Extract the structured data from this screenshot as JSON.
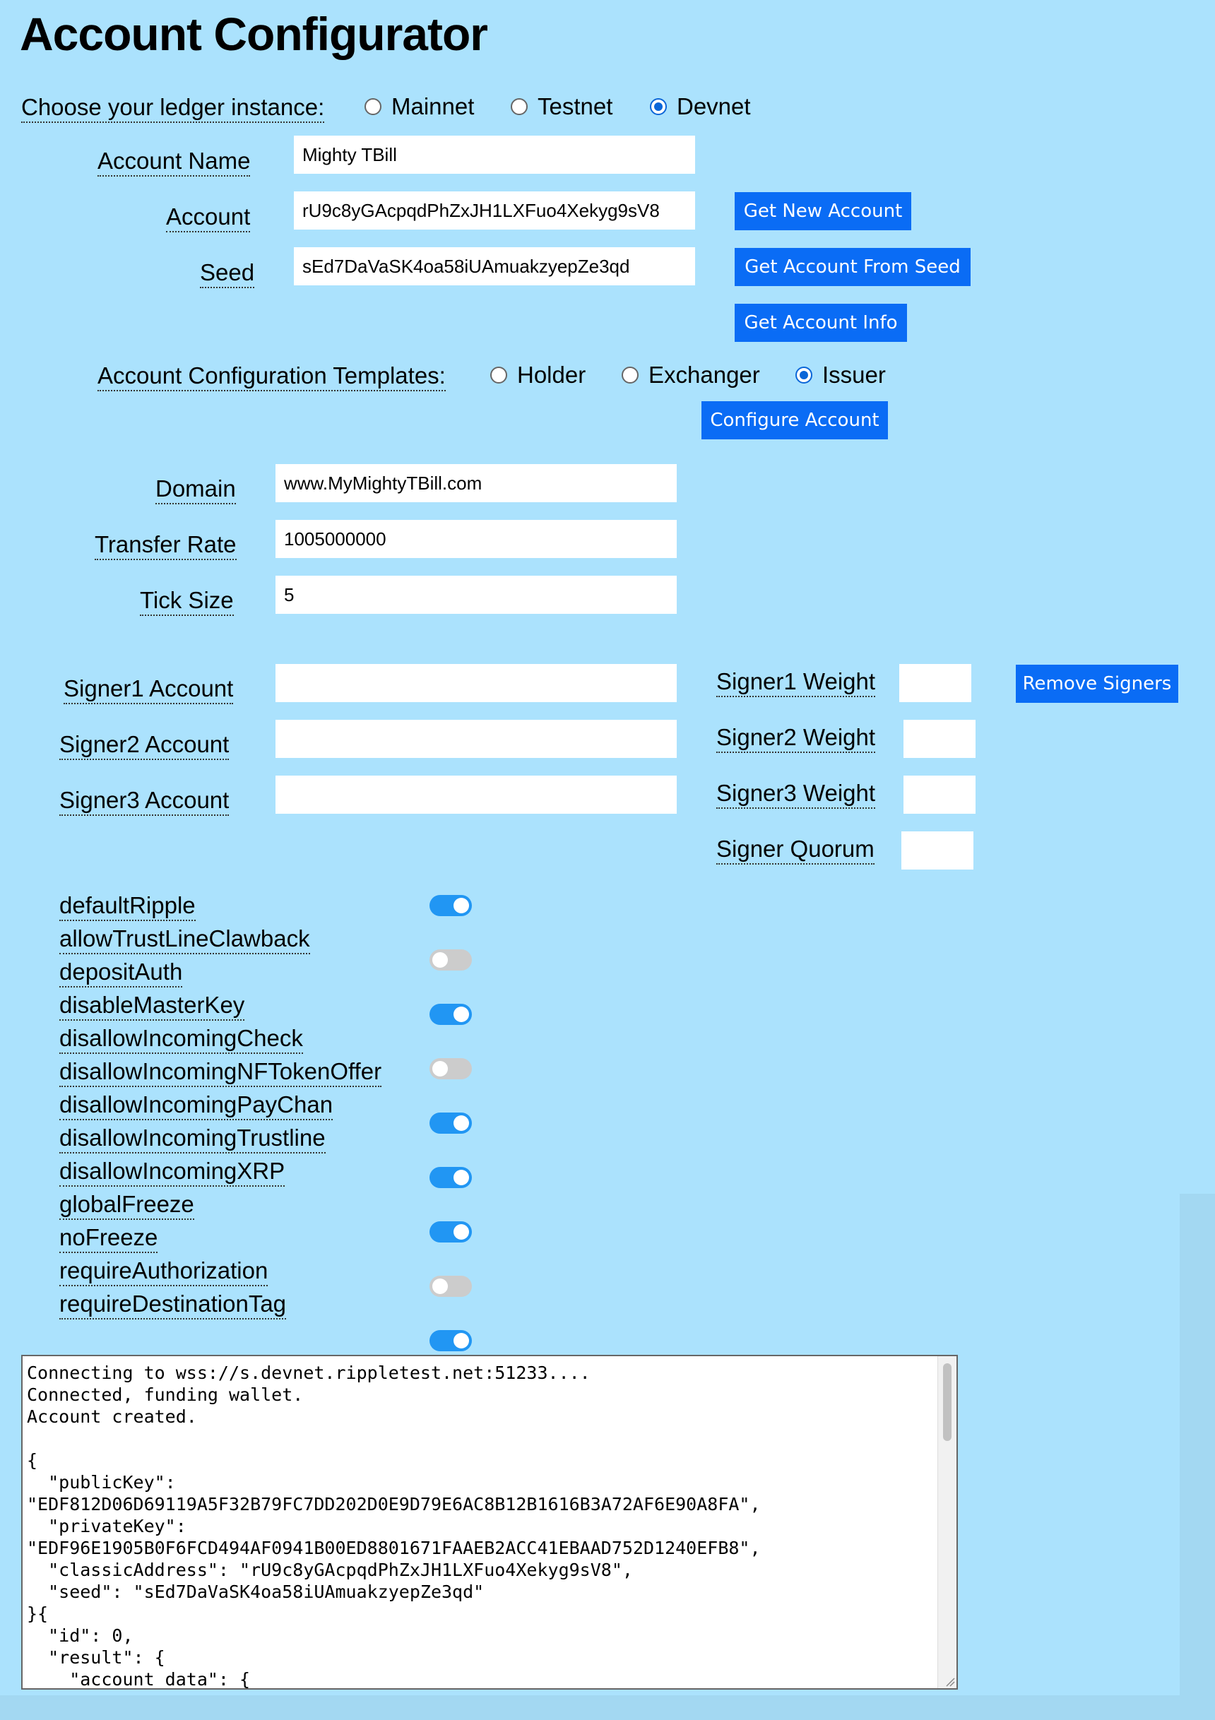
{
  "page": {
    "title": "Account Configurator"
  },
  "ledger": {
    "label": "Choose your ledger instance:",
    "options": [
      "Mainnet",
      "Testnet",
      "Devnet"
    ],
    "selected": "Devnet"
  },
  "account": {
    "name_label": "Account Name",
    "name_value": "Mighty TBill",
    "account_label": "Account",
    "account_value": "rU9c8yGAcpqdPhZxJH1LXFuo4Xekyg9sV8",
    "seed_label": "Seed",
    "seed_value": "sEd7DaVaSK4oa58iUAmuakzyepZe3qd",
    "get_new_account_button": "Get New Account",
    "get_from_seed_button": "Get Account From Seed",
    "get_info_button": "Get Account Info"
  },
  "templates": {
    "label": "Account Configuration Templates:",
    "options": [
      "Holder",
      "Exchanger",
      "Issuer"
    ],
    "selected": "Issuer",
    "configure_button": "Configure Account"
  },
  "settings": {
    "domain_label": "Domain",
    "domain_value": "www.MyMightyTBill.com",
    "transfer_rate_label": "Transfer Rate",
    "transfer_rate_value": "1005000000",
    "tick_size_label": "Tick Size",
    "tick_size_value": "5"
  },
  "signers": {
    "signer1_account_label": "Signer1 Account",
    "signer2_account_label": "Signer2 Account",
    "signer3_account_label": "Signer3 Account",
    "signer1_weight_label": "Signer1 Weight",
    "signer2_weight_label": "Signer2 Weight",
    "signer3_weight_label": "Signer3 Weight",
    "quorum_label": "Signer Quorum",
    "remove_button": "Remove Signers",
    "signer1_account_value": "",
    "signer2_account_value": "",
    "signer3_account_value": "",
    "signer1_weight_value": "",
    "signer2_weight_value": "",
    "signer3_weight_value": "",
    "quorum_value": ""
  },
  "flags": [
    {
      "name": "defaultRipple",
      "on": true
    },
    {
      "name": "allowTrustLineClawback",
      "on": false
    },
    {
      "name": "depositAuth",
      "on": true
    },
    {
      "name": "disableMasterKey",
      "on": false
    },
    {
      "name": "disallowIncomingCheck",
      "on": true
    },
    {
      "name": "disallowIncomingNFTokenOffer",
      "on": true
    },
    {
      "name": "disallowIncomingPayChan",
      "on": true
    },
    {
      "name": "disallowIncomingTrustline",
      "on": false
    },
    {
      "name": "disallowIncomingXRP",
      "on": true
    },
    {
      "name": "globalFreeze",
      "on": false
    },
    {
      "name": "noFreeze",
      "on": false
    },
    {
      "name": "requireAuthorization",
      "on": false
    },
    {
      "name": "requireDestinationTag",
      "on": false
    }
  ],
  "console": {
    "text": "Connecting to wss://s.devnet.rippletest.net:51233....\nConnected, funding wallet.\nAccount created.\n\n{\n  \"publicKey\":\n\"EDF812D06D69119A5F32B79FC7DD202D0E9D79E6AC8B12B1616B3A72AF6E90A8FA\",\n  \"privateKey\":\n\"EDF96E1905B0F6FCD494AF0941B00ED8801671FAAEB2ACC41EBAAD752D1240EFB8\",\n  \"classicAddress\": \"rU9c8yGAcpqdPhZxJH1LXFuo4Xekyg9sV8\",\n  \"seed\": \"sEd7DaVaSK4oa58iUAmuakzyepZe3qd\"\n}{\n  \"id\": 0,\n  \"result\": {\n    \"account_data\": {"
  }
}
